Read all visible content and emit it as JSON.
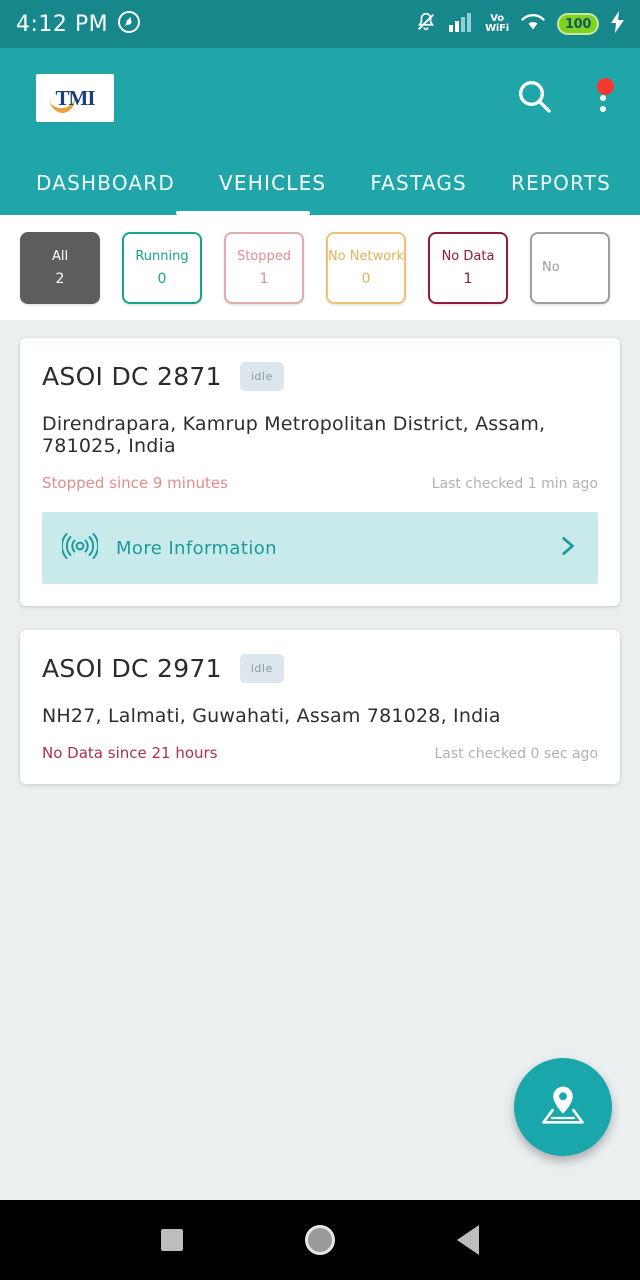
{
  "status_bar": {
    "time": "4:12 PM",
    "left_icons": [
      "location-icon"
    ],
    "right_icons": [
      "bell-muted-icon",
      "cellular-signal-icon",
      "volte-wifi-icon",
      "wifi-icon"
    ],
    "battery_level": "100",
    "charging": true
  },
  "app_bar": {
    "logo_text": "TMI",
    "search_icon": "search-icon",
    "overflow_icon": "more-vertical-icon",
    "has_notification": true
  },
  "tabs": {
    "items": [
      {
        "label": "DASHBOARD",
        "active": false
      },
      {
        "label": "VEHICLES",
        "active": true
      },
      {
        "label": "FASTAGS",
        "active": false
      },
      {
        "label": "REPORTS",
        "active": false
      }
    ]
  },
  "filters": {
    "chips": [
      {
        "label": "All",
        "count": "2",
        "color": "#ffffff",
        "selected": true
      },
      {
        "label": "Running",
        "count": "0",
        "color": "#17a589",
        "selected": false
      },
      {
        "label": "Stopped",
        "count": "1",
        "color": "#e08d95",
        "selected": false
      },
      {
        "label": "No Network",
        "count": "0",
        "color": "#e0b35c",
        "selected": false
      },
      {
        "label": "No Data",
        "count": "1",
        "color": "#8e1c3c",
        "selected": false
      },
      {
        "label": "No",
        "count": "",
        "color": "#9e9e9e",
        "selected": false
      }
    ]
  },
  "vehicles": [
    {
      "name": "ASOI DC 2871",
      "badge": "idle",
      "address": "Direndrapara, Kamrup Metropolitan District, Assam, 781025, India",
      "status": "Stopped since 9 minutes",
      "status_kind": "stopped",
      "last_checked": "Last checked 1 min ago",
      "more_information": {
        "label": "More Information",
        "icon": "broadcast-icon",
        "chevron": "chevron-right-icon"
      }
    },
    {
      "name": "ASOI DC 2971",
      "badge": "idle",
      "address": "NH27, Lalmati, Guwahati, Assam 781028, India",
      "status": "No Data since 21 hours",
      "status_kind": "nodata",
      "last_checked": "Last checked 0 sec ago",
      "more_information": null
    }
  ],
  "fab": {
    "icon": "map-pin-icon"
  },
  "nav_bar": {
    "recents": "square-icon",
    "home": "circle-icon",
    "back": "triangle-left-icon"
  },
  "theme": {
    "primary": "#20a6a8",
    "status_bar_bg": "#16878b",
    "page_bg": "#eceff0",
    "accent_teal": "#1d9a9c",
    "notification_red": "#f4392f"
  }
}
